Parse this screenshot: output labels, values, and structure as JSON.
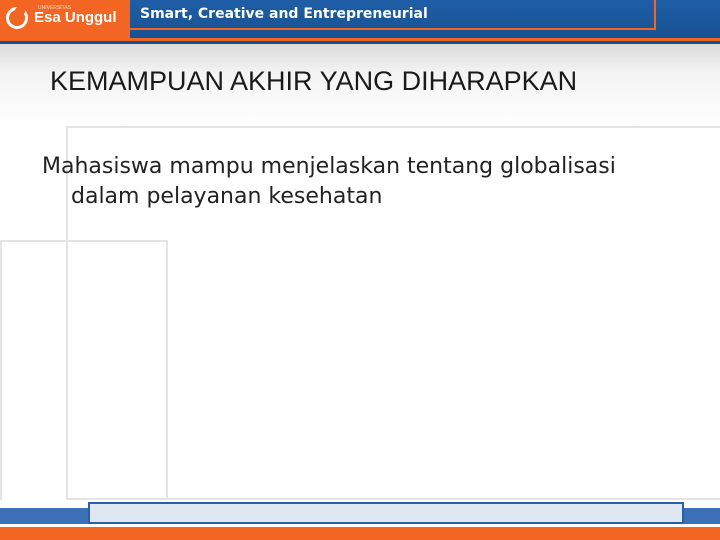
{
  "header": {
    "logo_small_text": "UNIVERSITAS",
    "logo_text": "Esa Unggul",
    "tagline": "Smart, Creative and Entrepreneurial"
  },
  "slide": {
    "title": "KEMAMPUAN AKHIR YANG DIHARAPKAN",
    "body_line1": "Mahasiswa mampu menjelaskan tentang globalisasi",
    "body_line2": "dalam pelayanan kesehatan"
  },
  "colors": {
    "brand_orange": "#f26522",
    "brand_blue": "#1f5ea6"
  }
}
